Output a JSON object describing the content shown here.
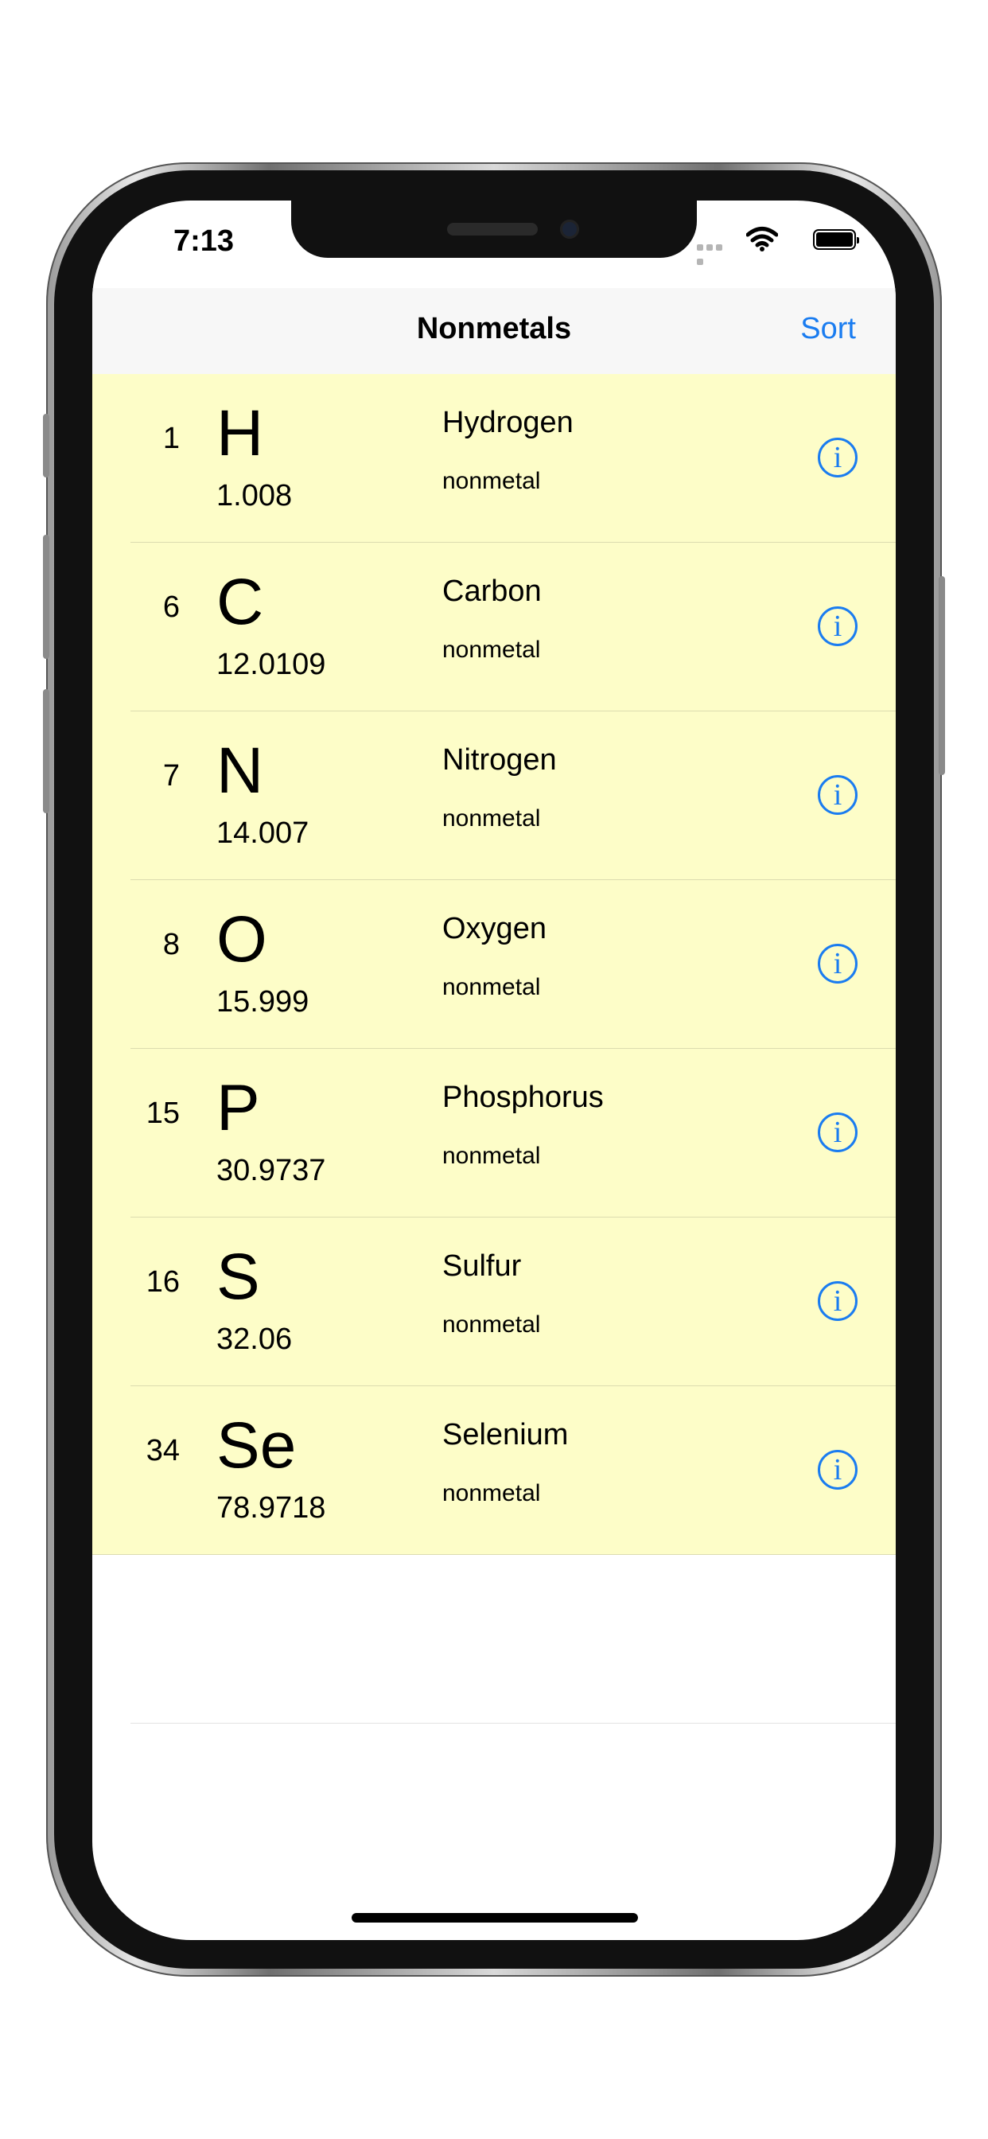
{
  "status_bar": {
    "time": "7:13"
  },
  "navbar": {
    "title": "Nonmetals",
    "sort_label": "Sort"
  },
  "elements": [
    {
      "number": "1",
      "symbol": "H",
      "mass": "1.008",
      "name": "Hydrogen",
      "category": "nonmetal"
    },
    {
      "number": "6",
      "symbol": "C",
      "mass": "12.0109",
      "name": "Carbon",
      "category": "nonmetal"
    },
    {
      "number": "7",
      "symbol": "N",
      "mass": "14.007",
      "name": "Nitrogen",
      "category": "nonmetal"
    },
    {
      "number": "8",
      "symbol": "O",
      "mass": "15.999",
      "name": "Oxygen",
      "category": "nonmetal"
    },
    {
      "number": "15",
      "symbol": "P",
      "mass": "30.9737",
      "name": "Phosphorus",
      "category": "nonmetal"
    },
    {
      "number": "16",
      "symbol": "S",
      "mass": "32.06",
      "name": "Sulfur",
      "category": "nonmetal"
    },
    {
      "number": "34",
      "symbol": "Se",
      "mass": "78.9718",
      "name": "Selenium",
      "category": "nonmetal"
    }
  ],
  "icons": {
    "info": "info-icon",
    "wifi": "wifi-icon",
    "battery": "battery-icon"
  },
  "colors": {
    "accent": "#1a7cf0",
    "row_background": "#fdfdc8"
  }
}
